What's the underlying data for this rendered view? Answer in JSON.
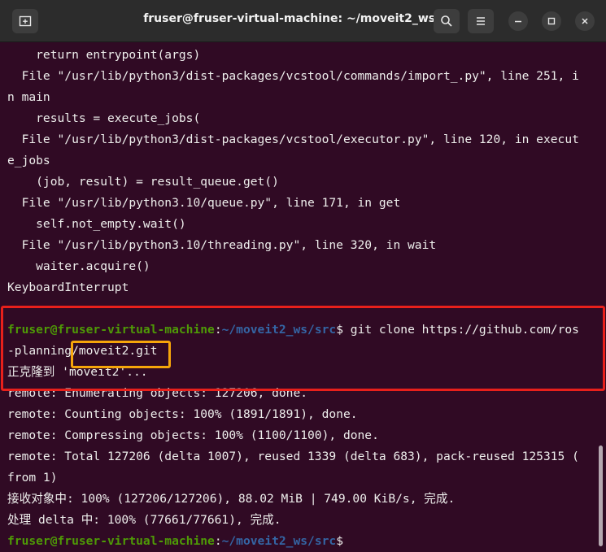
{
  "window": {
    "title": "fruser@fruser-virtual-machine: ~/moveit2_ws/src"
  },
  "icons": {
    "new_tab": "new-tab-icon",
    "search": "search-icon",
    "menu": "hamburger-menu-icon",
    "minimize": "minimize-icon",
    "maximize": "maximize-icon",
    "close": "close-icon"
  },
  "colors": {
    "background": "#300a24",
    "prompt_user": "#4e9a06",
    "prompt_path": "#3465a4",
    "highlight_red": "#e8201b",
    "highlight_orange": "#f5a50a"
  },
  "terminal": {
    "lines": [
      "    return entrypoint(args)",
      "  File \"/usr/lib/python3/dist-packages/vcstool/commands/import_.py\", line 251, i",
      "n main",
      "    results = execute_jobs(",
      "  File \"/usr/lib/python3/dist-packages/vcstool/executor.py\", line 120, in execut",
      "e_jobs",
      "    (job, result) = result_queue.get()",
      "  File \"/usr/lib/python3.10/queue.py\", line 171, in get",
      "    self.not_empty.wait()",
      "  File \"/usr/lib/python3.10/threading.py\", line 320, in wait",
      "    waiter.acquire()",
      "KeyboardInterrupt"
    ],
    "prompt": {
      "user": "fruser@fruser-virtual-machine",
      "colon": ":",
      "path": "~/moveit2_ws/src",
      "dollar": "$"
    },
    "command_1": " git clone https://github.com/ros",
    "command_2a": "-planning",
    "command_2b": "/moveit2.git",
    "output": [
      "正克隆到 'moveit2'...",
      "remote: Enumerating objects: 127206, done.",
      "remote: Counting objects: 100% (1891/1891), done.",
      "remote: Compressing objects: 100% (1100/1100), done.",
      "remote: Total 127206 (delta 1007), reused 1339 (delta 683), pack-reused 125315 (",
      "from 1)",
      "接收对象中: 100% (127206/127206), 88.02 MiB | 749.00 KiB/s, 完成.",
      "处理 delta 中: 100% (77661/77661), 完成."
    ]
  }
}
